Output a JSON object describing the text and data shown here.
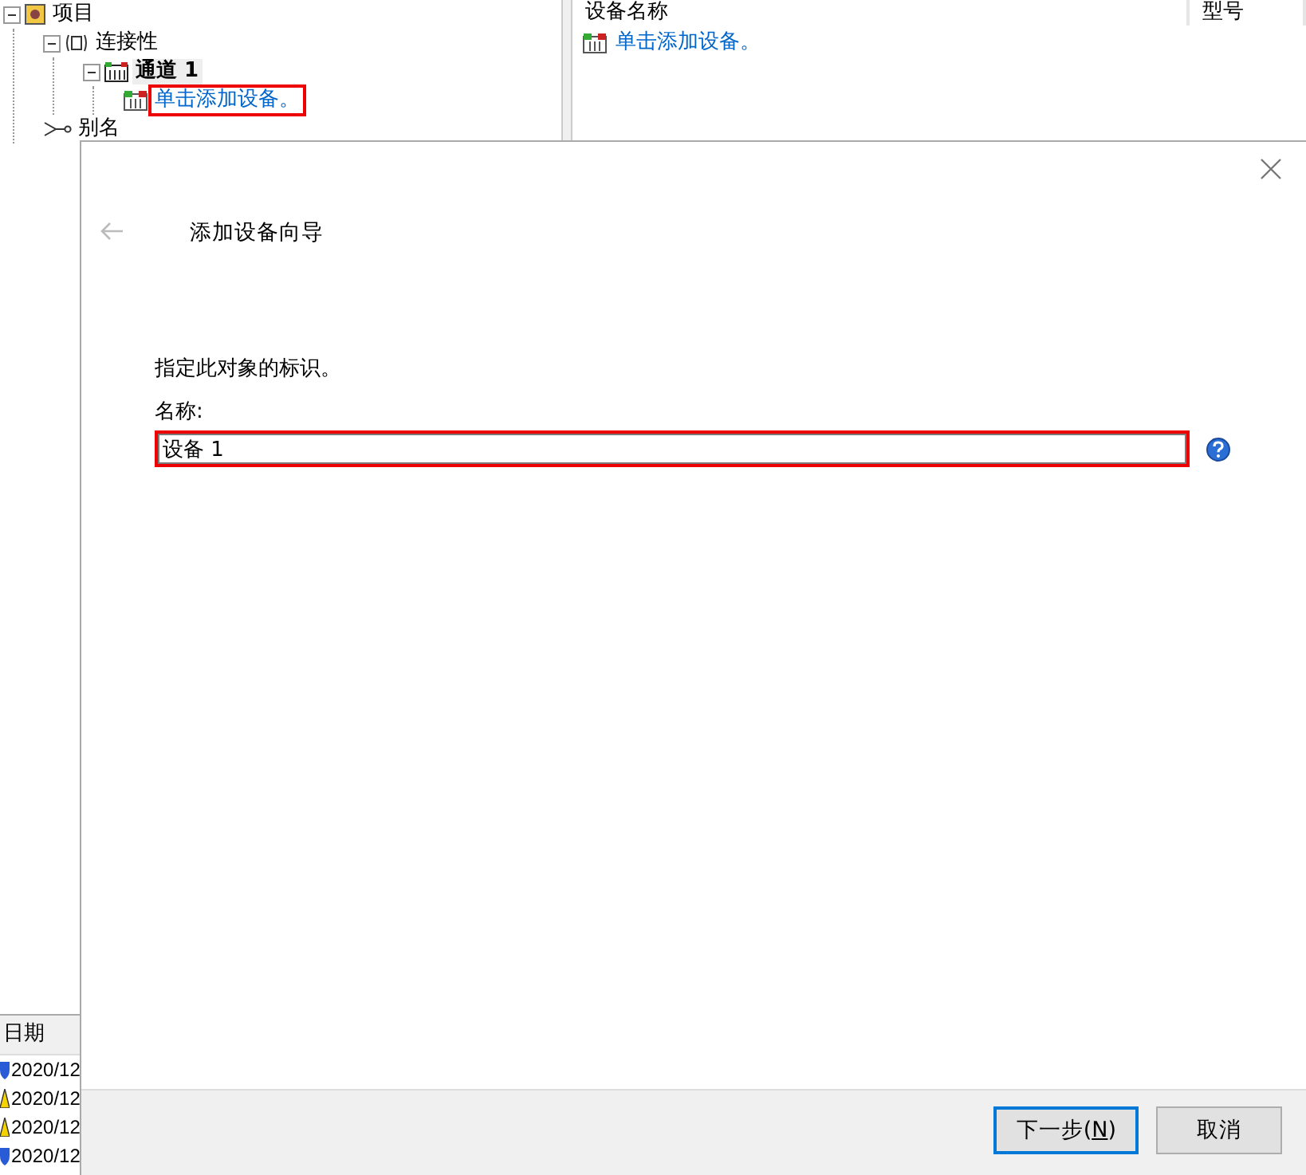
{
  "tree": [
    {
      "label": "项目",
      "kind": "project",
      "bold": false,
      "link": false,
      "highlighted": false,
      "expanded": true,
      "children": [
        {
          "label": "连接性",
          "kind": "connectivity",
          "bold": false,
          "link": false,
          "highlighted": false,
          "expanded": true,
          "children": [
            {
              "label": "通道 1",
              "kind": "channel",
              "bold": true,
              "link": false,
              "highlighted": false,
              "expanded": true,
              "children": [
                {
                  "label": "单击添加设备。",
                  "kind": "device",
                  "bold": false,
                  "link": true,
                  "highlighted": true
                }
              ]
            }
          ]
        },
        {
          "label": "别名",
          "kind": "alias",
          "bold": false,
          "link": false,
          "highlighted": false
        }
      ]
    }
  ],
  "device_list": {
    "columns": [
      "设备名称",
      "型号"
    ],
    "rows": [
      {
        "label": "单击添加设备。",
        "link": true
      }
    ]
  },
  "event_log": {
    "columns": [
      "日期"
    ],
    "rows": [
      {
        "kind": "info",
        "date": "2020/12"
      },
      {
        "kind": "warning",
        "date": "2020/12"
      },
      {
        "kind": "warning",
        "date": "2020/12"
      },
      {
        "kind": "info",
        "date": "2020/12"
      }
    ]
  },
  "dialog": {
    "title": "添加设备向导",
    "back_disabled": true,
    "description": "指定此对象的标识。",
    "field_label": "名称:",
    "field_value": "设备 1",
    "field_highlighted": true,
    "buttons": [
      {
        "before": "下一步(",
        "mnemonic": "N",
        "after": ")",
        "default": true
      },
      {
        "before": "取消",
        "default": false
      }
    ]
  }
}
